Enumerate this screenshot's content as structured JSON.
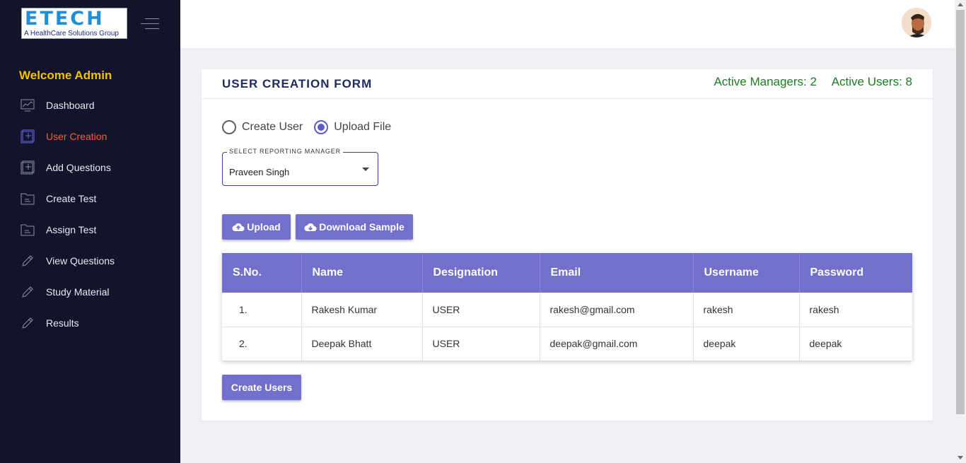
{
  "brand": {
    "logo_text": "ETECH",
    "logo_subtitle": "A HealthCare Solutions Group"
  },
  "sidebar": {
    "welcome": "Welcome Admin",
    "items": [
      {
        "label": "Dashboard",
        "icon": "dashboard-icon"
      },
      {
        "label": "User Creation",
        "icon": "add-square-icon",
        "active": true
      },
      {
        "label": "Add Questions",
        "icon": "add-square-icon"
      },
      {
        "label": "Create Test",
        "icon": "folder-icon"
      },
      {
        "label": "Assign Test",
        "icon": "folder-icon"
      },
      {
        "label": "View Questions",
        "icon": "pencil-icon"
      },
      {
        "label": "Study Material",
        "icon": "pencil-icon"
      },
      {
        "label": "Results",
        "icon": "pencil-icon"
      }
    ]
  },
  "form": {
    "title": "USER CREATION FORM",
    "active_managers": "Active Managers: 2",
    "active_users": "Active Users: 8",
    "radio_create": "Create User",
    "radio_upload": "Upload File",
    "selected_mode": "Upload File",
    "select_label": "SELECT REPORTING MANAGER",
    "select_value": "Praveen Singh",
    "upload_label": "Upload",
    "download_label": "Download Sample",
    "create_label": "Create Users"
  },
  "table": {
    "headers": [
      "S.No.",
      "Name",
      "Designation",
      "Email",
      "Username",
      "Password"
    ],
    "rows": [
      [
        "1.",
        "Rakesh Kumar",
        "USER",
        "rakesh@gmail.com",
        "rakesh",
        "rakesh"
      ],
      [
        "2.",
        "Deepak Bhatt",
        "USER",
        "deepak@gmail.com",
        "deepak",
        "deepak"
      ]
    ]
  },
  "colors": {
    "sidebar_bg": "#11142a",
    "accent": "#7270cc",
    "welcome": "#f2c200",
    "active_nav": "#ff5a3c",
    "stats": "#1d7a24"
  }
}
